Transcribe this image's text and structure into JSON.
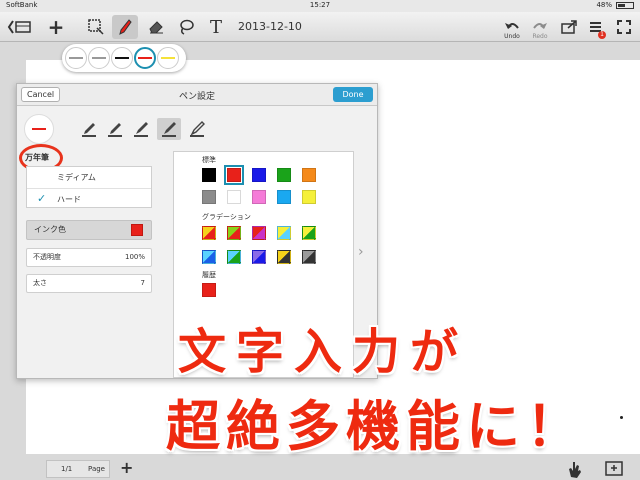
{
  "status_bar": {
    "carrier": "SoftBank",
    "time": "15:27",
    "battery": "48%",
    "battery_level": 0.48
  },
  "toolbar": {
    "date": "2013-12-10",
    "undo_label": "Undo",
    "redo_label": "Redo",
    "badge_count": "1",
    "icons": [
      "back-notebook-icon",
      "add-icon",
      "lasso-select-icon",
      "pen-icon",
      "eraser-icon",
      "lasso-icon",
      "text-icon",
      "undo-icon",
      "redo-icon",
      "share-icon",
      "page-list-icon",
      "fullscreen-icon"
    ]
  },
  "line_selector": {
    "options": [
      {
        "color": "#999999",
        "selected": false
      },
      {
        "color": "#999999",
        "selected": false
      },
      {
        "color": "#111111",
        "selected": false
      },
      {
        "color": "#e8211a",
        "selected": true
      },
      {
        "color": "#f5e23a",
        "selected": false
      }
    ]
  },
  "pen_dialog": {
    "cancel": "Cancel",
    "title": "ペン設定",
    "done": "Done",
    "pen_type": "万年筆",
    "options": [
      {
        "label": "ミディアム",
        "checked": false
      },
      {
        "label": "ハード",
        "checked": true
      }
    ],
    "ink_color_label": "インク色",
    "ink_color": "#e8211a",
    "opacity": {
      "label": "不透明度",
      "value": "100%"
    },
    "thickness": {
      "label": "太さ",
      "value": "7"
    },
    "palette": {
      "standard_label": "標準",
      "standard": [
        "#000000",
        "#e8211a",
        "#1a1ae8",
        "#1aa31a",
        "#f58a1a",
        "#8c8c8c",
        "#ffffff",
        "#f57bd8",
        "#1aa8f0",
        "#f5f03a"
      ],
      "selected": "#e8211a",
      "gradation_label": "グラデーション",
      "gradients": [
        [
          "#f5d21a",
          "#e8211a"
        ],
        [
          "#8ad21a",
          "#e8211a"
        ],
        [
          "#e8211a",
          "#c833c8"
        ],
        [
          "#f5f03a",
          "#5ad2ff"
        ],
        [
          "#f5f03a",
          "#1aa31a"
        ],
        [
          "#5ad2ff",
          "#1a60e8"
        ],
        [
          "#5ad2ff",
          "#1aa31a"
        ],
        [
          "#8a6ae8",
          "#1a1ae8"
        ],
        [
          "#f5d21a",
          "#333333"
        ],
        [
          "#9a9a9a",
          "#333333"
        ]
      ],
      "history_label": "履歴",
      "history": [
        "#e8211a"
      ]
    }
  },
  "overlay": {
    "line1": "文字入力が",
    "line2": "超絶多機能に！"
  },
  "bottom": {
    "page": "1/1",
    "page_label": "Page"
  }
}
